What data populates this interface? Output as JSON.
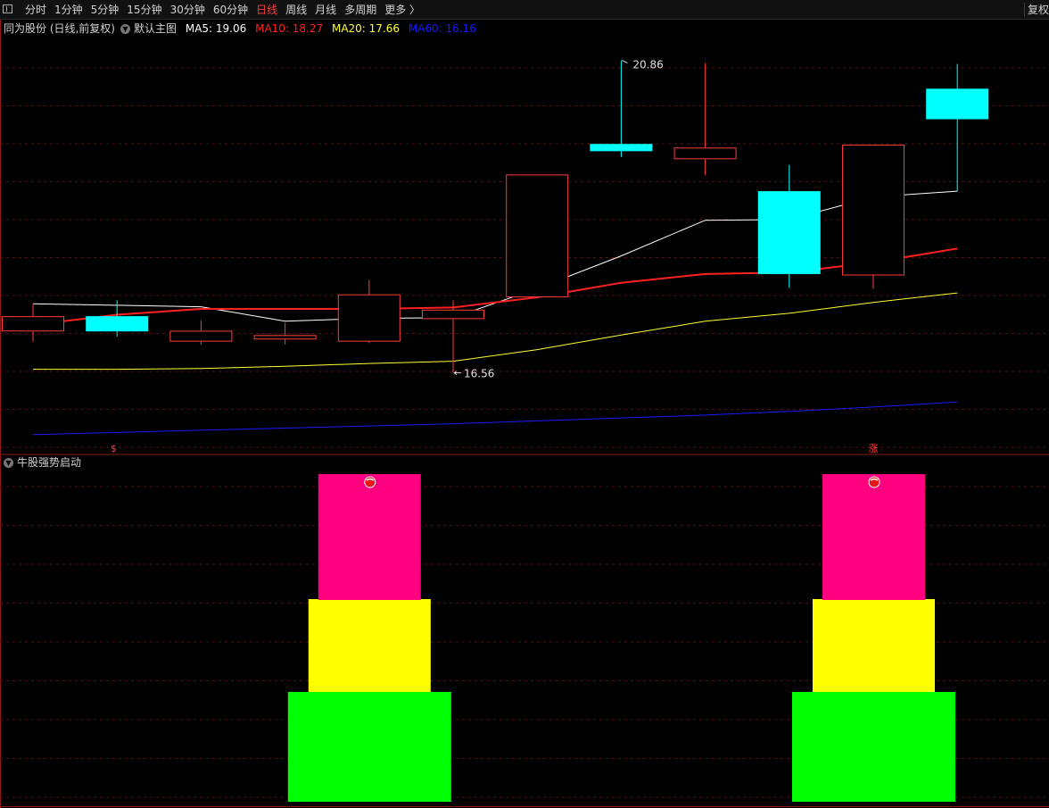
{
  "toolbar": {
    "periods": [
      "分时",
      "1分钟",
      "5分钟",
      "15分钟",
      "30分钟",
      "60分钟",
      "日线",
      "周线",
      "月线",
      "多周期",
      "更多 〉"
    ],
    "active_period": "日线",
    "right_button": "复权"
  },
  "info_bar": {
    "stock": "同为股份 (日线,前复权)",
    "template": "默认主图",
    "ma5": "MA5: 19.06",
    "ma10": "MA10: 18.27",
    "ma20": "MA20: 17.66",
    "ma60": "MA60: 16.16"
  },
  "colors": {
    "up": "#ff3b3b",
    "down": "#00ffff",
    "ma5": "#ffffff",
    "ma10": "#ff2020",
    "ma20": "#ffff33",
    "ma60": "#1a1aff",
    "bar_top": "#ff0080",
    "bar_mid": "#ffff00",
    "bar_bottom": "#00ff00",
    "grid": "#5a1010"
  },
  "sub_indicator": {
    "title": "牛股强势启动"
  },
  "chart_data": [
    {
      "type": "candlestick",
      "title": "同为股份 (日线,前复权)",
      "ylim": [
        15.45,
        21.42
      ],
      "annotations": {
        "high": "20.86",
        "low": "16.56"
      },
      "candles": [
        {
          "open": 17.13,
          "close": 17.34,
          "high": 17.51,
          "low": 16.99
        },
        {
          "open": 17.34,
          "close": 17.13,
          "high": 17.56,
          "low": 17.06
        },
        {
          "open": 16.99,
          "close": 17.14,
          "high": 17.28,
          "low": 16.95
        },
        {
          "open": 17.02,
          "close": 17.08,
          "high": 17.25,
          "low": 16.95
        },
        {
          "open": 16.99,
          "close": 17.64,
          "high": 17.84,
          "low": 16.97
        },
        {
          "open": 17.3,
          "close": 17.43,
          "high": 17.56,
          "low": 16.56
        },
        {
          "open": 17.6,
          "close": 19.29,
          "high": 19.29,
          "low": 17.6
        },
        {
          "open": 19.71,
          "close": 19.61,
          "high": 20.86,
          "low": 19.53
        },
        {
          "open": 19.5,
          "close": 19.66,
          "high": 20.82,
          "low": 19.28
        },
        {
          "open": 19.06,
          "close": 17.92,
          "high": 19.42,
          "low": 17.73
        },
        {
          "open": 17.9,
          "close": 19.7,
          "high": 19.7,
          "low": 17.72
        },
        {
          "open": 20.47,
          "close": 20.05,
          "high": 20.81,
          "low": 19.06
        }
      ],
      "series": [
        {
          "name": "MA5",
          "values": [
            17.51,
            17.49,
            17.47,
            17.27,
            17.31,
            17.32,
            17.72,
            18.17,
            18.66,
            18.67,
            18.98,
            19.06
          ]
        },
        {
          "name": "MA10",
          "values": [
            17.22,
            17.36,
            17.44,
            17.44,
            17.44,
            17.46,
            17.6,
            17.8,
            17.92,
            17.94,
            18.08,
            18.27
          ]
        },
        {
          "name": "MA20",
          "values": [
            16.61,
            16.61,
            16.62,
            16.65,
            16.69,
            16.72,
            16.88,
            17.08,
            17.27,
            17.38,
            17.53,
            17.66
          ]
        },
        {
          "name": "MA60",
          "values": [
            15.71,
            15.74,
            15.77,
            15.8,
            15.83,
            15.86,
            15.9,
            15.94,
            15.98,
            16.03,
            16.09,
            16.16
          ]
        }
      ],
      "signals": [
        {
          "index": 1,
          "text": "$"
        },
        {
          "index": 10,
          "text": "涨"
        }
      ]
    },
    {
      "type": "bar",
      "title": "牛股强势启动",
      "signal_days": [
        4,
        10
      ],
      "stack_levels": [
        "green",
        "yellow",
        "magenta"
      ]
    }
  ]
}
